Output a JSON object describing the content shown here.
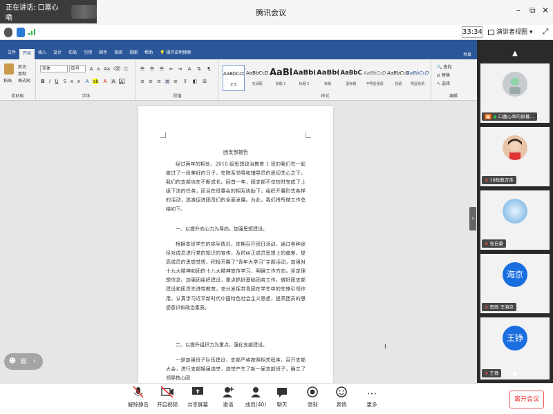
{
  "titlebar": {
    "speaking_label": "正在讲话: 口嘉心嘞",
    "app_title": "腾讯会议",
    "minimize": "–",
    "restore": "⧉",
    "close": "✕"
  },
  "toolbar": {
    "timer": "33:34",
    "presenter_view_label": "演讲者视图",
    "presenter_view_arrow": "▾",
    "fullscreen_icon": "⤢"
  },
  "word": {
    "tabs": [
      "文件",
      "开始",
      "插入",
      "设计",
      "布局",
      "引用",
      "邮件",
      "审阅",
      "视图",
      "帮助",
      "操作说明搜索"
    ],
    "share_label": "共享",
    "clipboard": {
      "paste": "粘贴",
      "cut": "剪切",
      "copy": "复制",
      "format_painter": "格式刷",
      "group": "剪贴板"
    },
    "font": {
      "name": "宋体",
      "size": "四号",
      "group": "字体"
    },
    "paragraph": {
      "group": "段落"
    },
    "styles": {
      "group": "样式",
      "items": [
        {
          "preview": "AaBbCcDt",
          "name": "正文"
        },
        {
          "preview": "AaBbCcDt",
          "name": "无间隔"
        },
        {
          "preview": "AaBl",
          "name": "标题 1"
        },
        {
          "preview": "AaBb(",
          "name": "标题 2"
        },
        {
          "preview": "AaBb(",
          "name": "标题"
        },
        {
          "preview": "AaBbC",
          "name": "副标题"
        },
        {
          "preview": "AaBbCcDt",
          "name": "不明显强调"
        },
        {
          "preview": "AaBbCcDt",
          "name": "强调"
        },
        {
          "preview": "AaBbCcDt",
          "name": "明显强调"
        }
      ]
    },
    "editing": {
      "find": "查找",
      "replace": "替换",
      "select": "选择",
      "group": "编辑"
    }
  },
  "document": {
    "title": "团支部报告",
    "p1": "经过两年的相处，2018 级思想政治教育 1 班的我们在一起度过了一段美好的日子，在院系领导和辅导员的悉切关心之下，我们的支部也在不断成长。回首一年，团支部不仅较时完成了上级下达的任务，而且在班委会的相互协助下，组织开展形式各样的活动，选准促进团员们的全面发展。为此，我们将所做工作总结如下。",
    "h1": "一、以提升向心力为导向，加强思想建设。",
    "p2": "根据本班学生的实际情况，定期召开团日活动，通过各种途径对成员进行党的知识的宣传，及时纠正成员思想上的偏差，提高成员的思想觉悟，积极开展了“青年大学习”主题活动，加强对十九大精神和团的十八大精神宣传学习，明确工作方向，坚定理想信念。加强团组织建设，重点抓好基础团务工作，做好团支部建设和团员先进性教育，充分发挥共青团在学生中的先锋引领作用，认真学习近平新时代中国特色社会主义思想，提高团员的思想意识和政治素质。",
    "h2": "二、以提升组织力为重点，强化支部建设。",
    "p3": "一是加强班子队伍建设，支部严格按照相关程序，召开支部大会，进行支部换届选举，选举产生了新一届支部班子，确立了领导核心团"
  },
  "participants": [
    {
      "name": "口嘉心率的屏幕...",
      "avatar": "placeholder-avatar"
    },
    {
      "name": "18政教方序",
      "avatar": "child-photo"
    },
    {
      "name": "张自豪",
      "avatar": "blue-sky-photo"
    },
    {
      "name": "思政 王海京",
      "avatar_text": "海京"
    },
    {
      "name": "王铮",
      "avatar_text": "王铮"
    }
  ],
  "bottombar": {
    "buttons": [
      {
        "label": "解除静音",
        "icon": "mic-muted-icon"
      },
      {
        "label": "开启视频",
        "icon": "video-off-icon"
      },
      {
        "label": "共享屏幕",
        "icon": "screen-share-icon"
      },
      {
        "label": "邀请",
        "icon": "invite-icon"
      },
      {
        "label": "成员(40)",
        "icon": "members-icon"
      },
      {
        "label": "聊天",
        "icon": "chat-icon"
      },
      {
        "label": "录制",
        "icon": "record-icon"
      },
      {
        "label": "表情",
        "icon": "emoji-icon"
      },
      {
        "label": "更多",
        "icon": "more-icon"
      }
    ],
    "leave_label": "离开会议"
  },
  "colors": {
    "word_blue": "#2b579a",
    "leave_red": "#e33333",
    "avatar_blue": "#1a6fe0",
    "panel_bg": "#2a2a2a"
  }
}
